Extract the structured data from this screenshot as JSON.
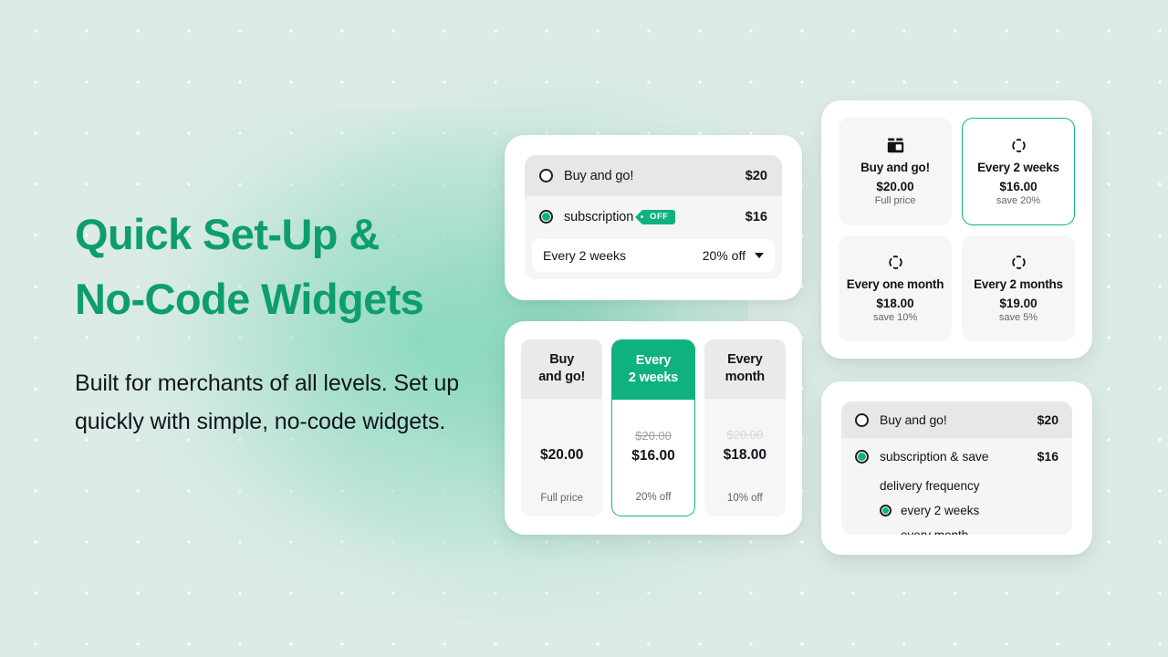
{
  "theme": {
    "background": "#dcebe6",
    "accent_green": "#0fb27e",
    "heading_green": "#0e9e6e",
    "text_dark": "#111418",
    "muted": "#5f6368"
  },
  "hero": {
    "headline_line1": "Quick Set-Up &",
    "headline_line2": "No-Code Widgets",
    "subcopy": "Built for merchants of all levels. Set up quickly with simple, no-code widgets."
  },
  "widget_radio_simple": {
    "options": [
      {
        "label": "Buy and go!",
        "price": "$20",
        "selected": false
      },
      {
        "label": "subscription",
        "badge": "OFF",
        "price": "$16",
        "selected": true
      }
    ],
    "dropdown": {
      "value": "Every 2 weeks",
      "discount": "20% off",
      "caret_icon": "chevron-down-icon"
    }
  },
  "widget_columns": {
    "columns": [
      {
        "title_line1": "Buy",
        "title_line2": "and go!",
        "old_price": "",
        "price": "$20.00",
        "note": "Full price",
        "active": false,
        "old_price_faded": false
      },
      {
        "title_line1": "Every",
        "title_line2": "2 weeks",
        "old_price": "$20.00",
        "price": "$16.00",
        "note": "20% off",
        "active": true,
        "old_price_faded": false
      },
      {
        "title_line1": "Every",
        "title_line2": "month",
        "old_price": "$20.00",
        "price": "$18.00",
        "note": "10% off",
        "active": false,
        "old_price_faded": true
      }
    ]
  },
  "widget_tiles": {
    "tiles": [
      {
        "icon": "package-box-icon",
        "title": "Buy and go!",
        "price": "$20.00",
        "note": "Full price",
        "active": false
      },
      {
        "icon": "recurring-cycle-icon",
        "title": "Every 2 weeks",
        "price": "$16.00",
        "note": "save 20%",
        "active": true
      },
      {
        "icon": "recurring-cycle-icon",
        "title": "Every one month",
        "price": "$18.00",
        "note": "save 10%",
        "active": false
      },
      {
        "icon": "recurring-cycle-icon",
        "title": "Every 2 months",
        "price": "$19.00",
        "note": "save 5%",
        "active": false
      }
    ]
  },
  "widget_radio_nested": {
    "buy_once": {
      "label": "Buy and go!",
      "price": "$20",
      "selected": false
    },
    "subscription": {
      "label": "subscription & save",
      "price": "$16",
      "selected": true
    },
    "frequency_label": "delivery frequency",
    "frequency_options": [
      {
        "label": "every 2 weeks",
        "selected": true
      },
      {
        "label": "every month",
        "selected": false
      }
    ]
  }
}
